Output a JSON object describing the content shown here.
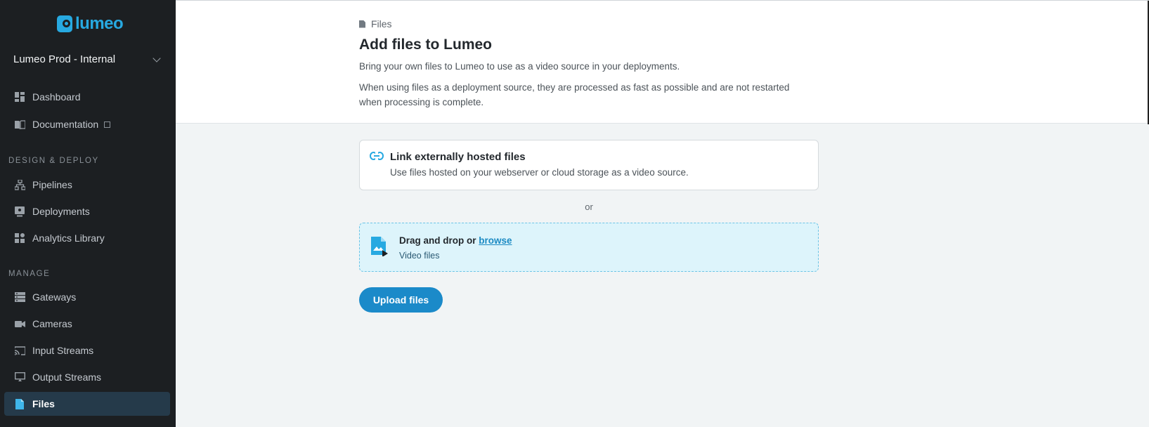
{
  "brand": {
    "name": "lumeo",
    "accent": "#27a9e1"
  },
  "org": {
    "name": "Lumeo Prod - Internal"
  },
  "sidebar": {
    "top_items": [
      {
        "label": "Dashboard",
        "icon": "dashboard-icon"
      },
      {
        "label": "Documentation",
        "icon": "book-icon",
        "external": true
      }
    ],
    "sections": [
      {
        "title": "DESIGN & DEPLOY",
        "items": [
          {
            "label": "Pipelines",
            "icon": "pipeline-icon"
          },
          {
            "label": "Deployments",
            "icon": "deployment-icon"
          },
          {
            "label": "Analytics Library",
            "icon": "analytics-icon"
          }
        ]
      },
      {
        "title": "MANAGE",
        "items": [
          {
            "label": "Gateways",
            "icon": "gateway-icon"
          },
          {
            "label": "Cameras",
            "icon": "camera-icon"
          },
          {
            "label": "Input Streams",
            "icon": "cast-icon"
          },
          {
            "label": "Output Streams",
            "icon": "monitor-icon"
          },
          {
            "label": "Files",
            "icon": "file-icon",
            "active": true
          }
        ]
      }
    ]
  },
  "header": {
    "breadcrumb": "Files",
    "title": "Add files to Lumeo",
    "description1": "Bring your own files to Lumeo to use as a video source in your deployments.",
    "description2": "When using files as a deployment source, they are processed as fast as possible and are not restarted when processing is complete."
  },
  "link_card": {
    "title": "Link externally hosted files",
    "subtitle": "Use files hosted on your webserver or cloud storage as a video source."
  },
  "separator": "or",
  "dropzone": {
    "prefix": "Drag and drop or ",
    "browse_label": "browse",
    "hint": "Video files"
  },
  "upload_button": "Upload files"
}
